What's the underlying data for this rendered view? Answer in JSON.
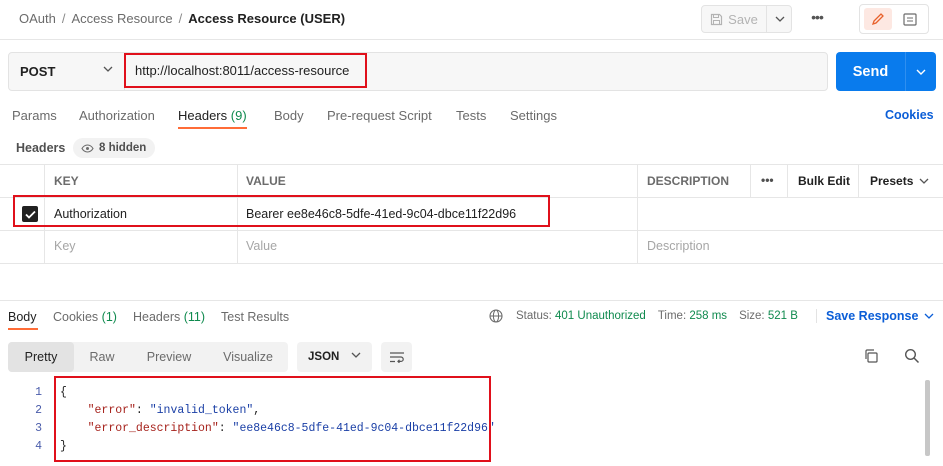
{
  "breadcrumb": {
    "root": "OAuth",
    "folder": "Access Resource",
    "current": "Access Resource (USER)",
    "separator": "/"
  },
  "toolbar": {
    "save_label": "Save",
    "more_label": "•••"
  },
  "request": {
    "method": "POST",
    "url": "http://localhost:8011/access-resource",
    "send_label": "Send"
  },
  "request_tabs": [
    {
      "label": "Params"
    },
    {
      "label": "Authorization"
    },
    {
      "label": "Headers",
      "count": "(9)",
      "active": true
    },
    {
      "label": "Body"
    },
    {
      "label": "Pre-request Script"
    },
    {
      "label": "Tests"
    },
    {
      "label": "Settings"
    }
  ],
  "cookies_link": "Cookies",
  "headers_section": {
    "title": "Headers",
    "hidden_badge": "8 hidden"
  },
  "headers_table": {
    "columns": {
      "key": "KEY",
      "value": "VALUE",
      "description": "DESCRIPTION",
      "more": "•••",
      "bulk_edit": "Bulk Edit",
      "presets": "Presets"
    },
    "rows": [
      {
        "checked": true,
        "key": "Authorization",
        "value": "Bearer ee8e46c8-5dfe-41ed-9c04-dbce11f22d96",
        "description": ""
      }
    ],
    "placeholder": {
      "key": "Key",
      "value": "Value",
      "description": "Description"
    }
  },
  "response_tabs": [
    {
      "label": "Body",
      "active": true
    },
    {
      "label": "Cookies",
      "count": "(1)"
    },
    {
      "label": "Headers",
      "count": "(11)"
    },
    {
      "label": "Test Results"
    }
  ],
  "response_meta": {
    "status_label": "Status:",
    "status_value": "401 Unauthorized",
    "time_label": "Time:",
    "time_value": "258 ms",
    "size_label": "Size:",
    "size_value": "521 B",
    "save_response": "Save Response"
  },
  "view_modes": [
    {
      "label": "Pretty",
      "active": true
    },
    {
      "label": "Raw"
    },
    {
      "label": "Preview"
    },
    {
      "label": "Visualize"
    }
  ],
  "format": "JSON",
  "response_body": {
    "line_numbers": [
      "1",
      "2",
      "3",
      "4"
    ],
    "open_brace": "{",
    "close_brace": "}",
    "fields": [
      {
        "key": "\"error\"",
        "value": "\"invalid_token\"",
        "trailing": ","
      },
      {
        "key": "\"error_description\"",
        "value": "\"ee8e46c8-5dfe-41ed-9c04-dbce11f22d96\"",
        "trailing": ""
      }
    ]
  },
  "colors": {
    "accent": "#ff6c37",
    "send": "#097bed",
    "link": "#0b5ed7",
    "highlight": "#e0101b",
    "status_ok": "#0f8a4e"
  }
}
